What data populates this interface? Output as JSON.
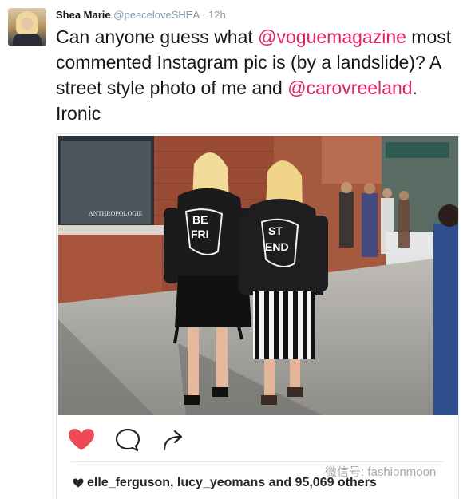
{
  "tweet": {
    "author_name": "Shea Marie",
    "handle": "@peaceloveSHEA",
    "separator": "·",
    "time": "12h",
    "text_1": "Can anyone guess what ",
    "mention_1": "@voguemagazine",
    "text_2": " most commented Instagram pic is (by a landslide)? A street style photo of me and ",
    "mention_2": "@carovreeland",
    "text_3": ". Ironic"
  },
  "photo": {
    "shop_sign": "ANTHROPOLOGIE",
    "jacket_left": [
      "BE",
      "FRI"
    ],
    "jacket_right": [
      "ST",
      "END"
    ]
  },
  "instagram": {
    "likes_text": "elle_ferguson, lucy_yeomans and 95,069 others",
    "like_color": "#ed4956"
  },
  "watermark": "微信号: fashionmoon",
  "colors": {
    "mention": "#e0245e",
    "meta": "#8899a6"
  }
}
